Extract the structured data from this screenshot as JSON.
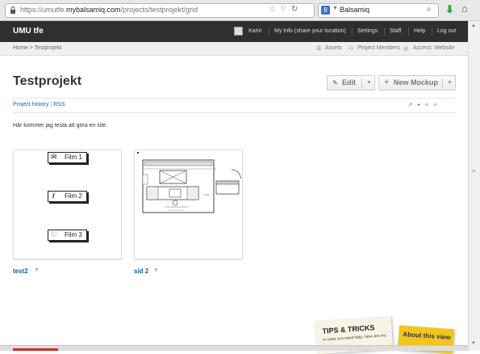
{
  "browser": {
    "url_prefix": "https://umutfe.",
    "url_domain": "mybalsamiq.com",
    "url_path": "/projects/testprojekt/grid",
    "search_engine_icon": "8",
    "search_text": "Balsamiq"
  },
  "header": {
    "brand": "UMU tfe",
    "user_name": "Karin",
    "nav": [
      "My Info (share your location)",
      "Settings",
      "Staff",
      "Help",
      "Log out"
    ]
  },
  "breadcrumb": {
    "text": "Home > Testprojekt",
    "tools": [
      "Assets",
      "Project Members",
      "Access: Website"
    ]
  },
  "project": {
    "title": "Testprojekt",
    "edit_label": "Edit",
    "new_mockup_label": "New Mockup",
    "history_link": "Project history",
    "rss_link": "RSS",
    "description": "Här kommer jag testa att göra en site."
  },
  "mockups": [
    {
      "label": "test2",
      "films": [
        "Film 1",
        "Film 2",
        "Film 3"
      ]
    },
    {
      "label": "sid 2"
    }
  ],
  "tips": {
    "title": "TIPS & TRICKS",
    "subtitle": "In case you need help, here are my",
    "about": "About this view"
  },
  "colors": {
    "header_bg": "#2f2f2f",
    "link": "#1a5fa0",
    "tips_yellow": "#f3c41e"
  }
}
